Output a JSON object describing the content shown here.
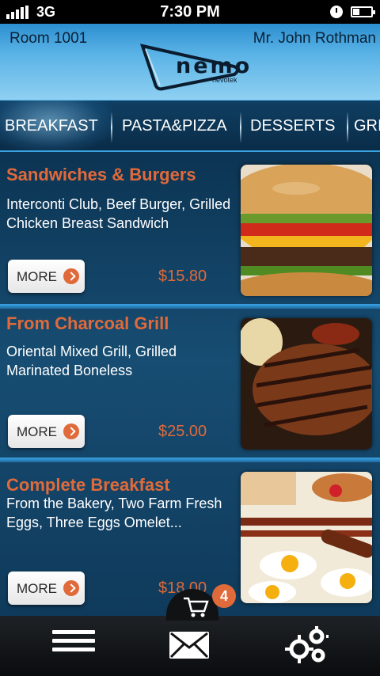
{
  "status_bar": {
    "network": "3G",
    "time": "7:30 PM"
  },
  "header": {
    "room": "Room  1001",
    "guest_name": "Mr. John Rothman",
    "logo_word": "nemo",
    "logo_sub": "nevotek"
  },
  "tabs": [
    {
      "label": "BREAKFAST",
      "active": true
    },
    {
      "label": "PASTA&PIZZA",
      "active": false
    },
    {
      "label": "DESSERTS",
      "active": false
    },
    {
      "label": "GRI",
      "active": false
    }
  ],
  "menu_items": [
    {
      "title": "Sandwiches & Burgers",
      "description": "Interconti Club, Beef Burger, Grilled Chicken Breast Sandwich",
      "more_label": "MORE",
      "price": "$15.80",
      "photo_icon": "burger-photo"
    },
    {
      "title": "From Charcoal Grill",
      "description": "Oriental Mixed Grill, Grilled Marinated Boneless",
      "more_label": "MORE",
      "price": "$25.00",
      "photo_icon": "steak-photo"
    },
    {
      "title": "Complete Breakfast",
      "description": "From the Bakery, Two Farm Fresh Eggs, Three Eggs Omelet...",
      "more_label": "MORE",
      "price": "$18.00",
      "photo_icon": "breakfast-photo"
    }
  ],
  "cart": {
    "count": "4",
    "icon": "cart-icon"
  },
  "bottom_bar": {
    "icons": [
      "menu-icon",
      "mail-icon",
      "settings-gear-icon"
    ]
  },
  "colors": {
    "accent": "#e06a3a",
    "header_blue": "#5ab3e6",
    "list_bg": "#174d72"
  }
}
